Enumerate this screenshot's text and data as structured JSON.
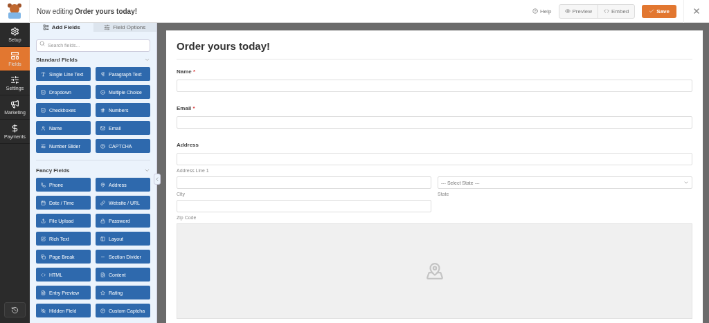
{
  "header": {
    "title": "Now editing **Order yours today!**",
    "help": "Help",
    "preview": "Preview",
    "embed": "Embed",
    "save": "Save"
  },
  "nav": [
    {
      "label": "Setup",
      "selected": false
    },
    {
      "label": "Fields",
      "selected": true
    },
    {
      "label": "Settings",
      "selected": false
    },
    {
      "label": "Marketing",
      "selected": false
    },
    {
      "label": "Payments",
      "selected": false
    }
  ],
  "panel": {
    "tabs": [
      {
        "label": "Add Fields",
        "selected": true
      },
      {
        "label": "Field Options",
        "selected": false
      }
    ],
    "search": {
      "placeholder": "Search fields..."
    },
    "sections": [
      {
        "title": "Standard Fields",
        "expanded": true,
        "fields": [
          "Single Line Text",
          "Paragraph Text",
          "Dropdown",
          "Multiple Choice",
          "Checkboxes",
          "Numbers",
          "Name",
          "Email",
          "Number Slider",
          "CAPTCHA"
        ]
      },
      {
        "title": "Fancy Fields",
        "expanded": true,
        "fields": [
          "Phone",
          "Address",
          "Date / Time",
          "Website / URL",
          "File Upload",
          "Password",
          "Rich Text",
          "Layout",
          "Page Break",
          "Section Divider",
          "HTML",
          "Content",
          "Entry Preview",
          "Rating",
          "Hidden Field",
          "Custom Captcha"
        ]
      }
    ]
  },
  "form": {
    "title": "Order yours today!",
    "fields": [
      {
        "kind": "text",
        "label": "Name",
        "mark": "*"
      },
      {
        "kind": "text",
        "label": "Email",
        "mark": "*"
      },
      {
        "kind": "address",
        "label": "Address",
        "line1": "Address Line 1",
        "city": "City",
        "state_placeholder": "--- Select State ---",
        "state": "State",
        "zip": "Zip Code"
      }
    ]
  }
}
